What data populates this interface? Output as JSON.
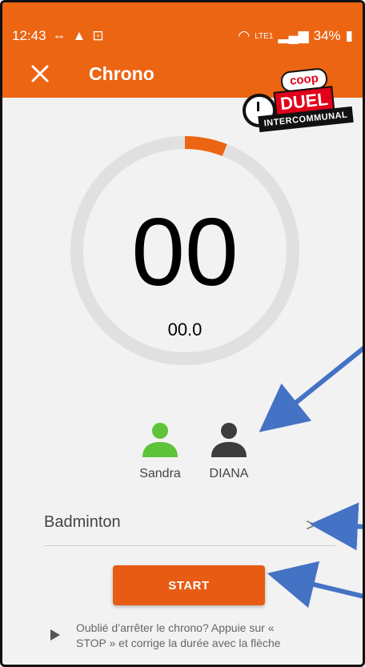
{
  "status_bar": {
    "time": "12:43",
    "battery": "34%",
    "network": "LTE1"
  },
  "app_bar": {
    "close_icon": "close-icon",
    "title": "Chrono"
  },
  "logo": {
    "coop": "coop",
    "duel": "DUEL",
    "intercommunal": "INTERCOMMUNAL"
  },
  "timer": {
    "seconds": "00",
    "tenths": "00.0",
    "progress_fraction": 0.06,
    "ring_color": "#e0e0e0",
    "progress_color": "#ec6513"
  },
  "players": [
    {
      "name": "Sandra",
      "color": "#5dc43a",
      "icon": "person-icon"
    },
    {
      "name": "DIANA",
      "color": "#3c3c3c",
      "icon": "person-icon"
    }
  ],
  "sport": {
    "name": "Badminton",
    "chevron": ">"
  },
  "start_button": {
    "label": "START",
    "color": "#e75b12"
  },
  "hint": {
    "line1": "Oublié d’arrêter le chrono? Appuie sur «",
    "line2": "STOP » et corrige la durée avec la flèche"
  },
  "colors": {
    "brand": "#ec6513",
    "annotation_arrow": "#4472c4"
  }
}
